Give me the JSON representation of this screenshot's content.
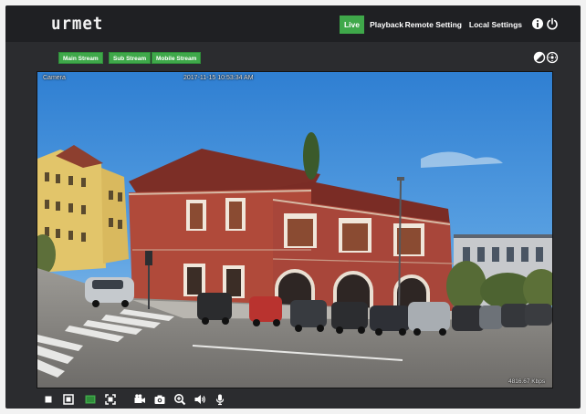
{
  "header": {
    "logo": "urmet",
    "nav": [
      {
        "label": "Live",
        "active": true
      },
      {
        "label": "Playback",
        "active": false
      },
      {
        "label": "Remote Setting",
        "active": false
      },
      {
        "label": "Local Settings",
        "active": false
      }
    ],
    "icons": [
      "info-icon",
      "power-icon"
    ]
  },
  "streams": {
    "tabs": [
      "Main Stream",
      "Sub Stream",
      "Mobile Stream"
    ],
    "icons": [
      "contrast-icon",
      "ptz-icon"
    ]
  },
  "video": {
    "camera_name": "Camera",
    "timestamp": "2017-11-15 10:53:34 AM",
    "bitrate": "4816.67 Kbps"
  },
  "toolbar": {
    "buttons": [
      "stop-icon",
      "window-icon",
      "stream-mode-icon",
      "fullscreen-icon",
      "record-icon",
      "snapshot-icon",
      "zoom-icon",
      "audio-icon",
      "microphone-icon"
    ]
  },
  "colors": {
    "accent": "#3fa84a",
    "background": "#2b2c2f",
    "header": "#1f2023"
  }
}
